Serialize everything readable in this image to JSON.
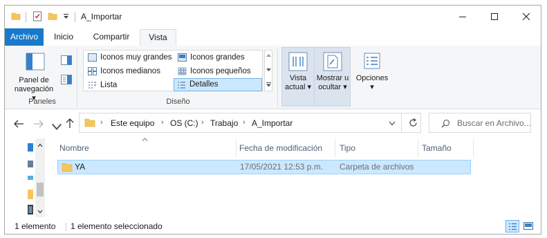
{
  "window": {
    "title": "A_Importar"
  },
  "tabs": {
    "archivo": "Archivo",
    "inicio": "Inicio",
    "compartir": "Compartir",
    "vista": "Vista"
  },
  "ribbon": {
    "panel_navegacion": [
      "Panel de",
      "navegación"
    ],
    "panels_group": "Paneles",
    "layout_group": "Diseño",
    "layout_items": [
      "Iconos muy grandes",
      "Iconos grandes",
      "Iconos medianos",
      "Iconos pequeños",
      "Lista",
      "Detalles"
    ],
    "layout_selected": "Detalles",
    "vista_actual": [
      "Vista",
      "actual"
    ],
    "mostrar_ocultar": [
      "Mostrar u",
      "ocultar"
    ],
    "opciones": "Opciones"
  },
  "address": {
    "crumbs": [
      "Este equipo",
      "OS (C:)",
      "Trabajo",
      "A_Importar"
    ],
    "search_placeholder": "Buscar en Archivo..."
  },
  "columns": [
    "Nombre",
    "Fecha de modificación",
    "Tipo",
    "Tamaño"
  ],
  "files": [
    {
      "name": "YA",
      "modified": "17/05/2021 12:53 p.m.",
      "type": "Carpeta de archivos",
      "size": ""
    }
  ],
  "status": {
    "count": "1 elemento",
    "selected": "1 elemento seleccionado"
  },
  "colors": {
    "accent": "#1979ca",
    "selection": "#cce8ff",
    "folder": "#f7c65a"
  }
}
